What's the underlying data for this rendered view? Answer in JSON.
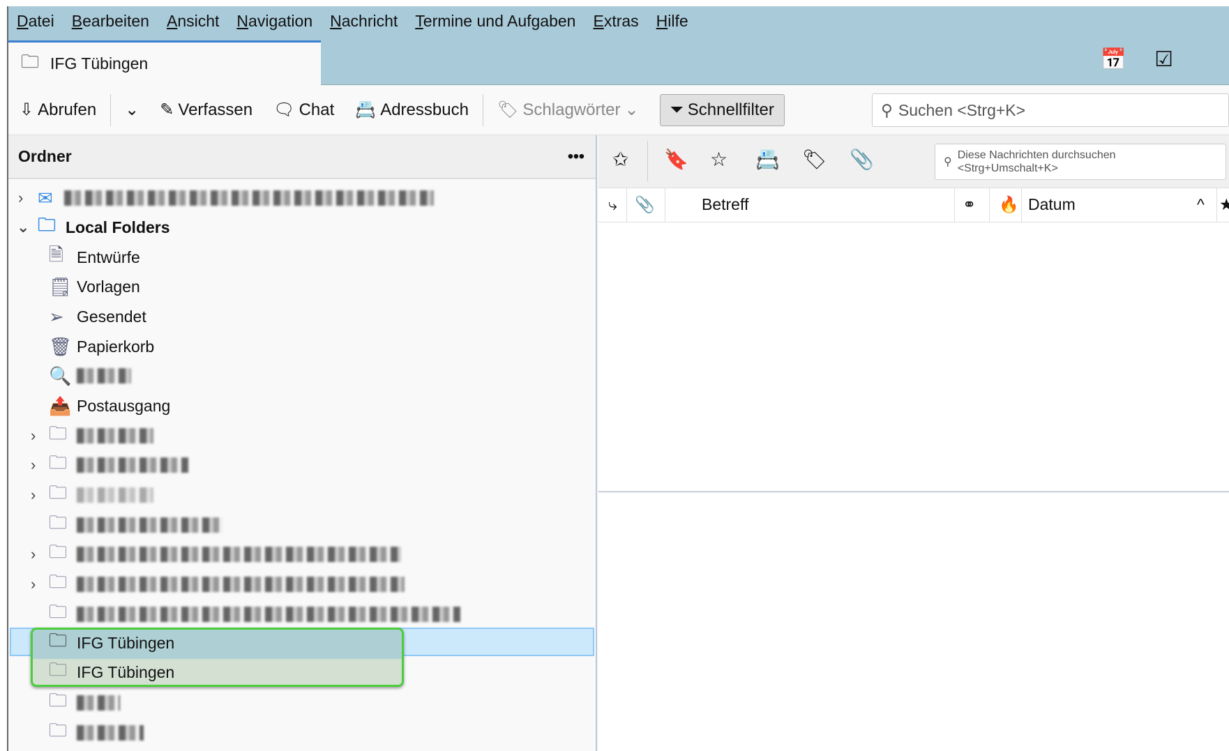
{
  "menu": [
    "Datei",
    "Bearbeiten",
    "Ansicht",
    "Navigation",
    "Nachricht",
    "Termine und Aufgaben",
    "Extras",
    "Hilfe"
  ],
  "tab": {
    "title": "IFG Tübingen"
  },
  "toolbar": {
    "get": "Abrufen",
    "write": "Verfassen",
    "chat": "Chat",
    "addressbook": "Adressbuch",
    "tags": "Schlagwörter",
    "quickfilter": "Schnellfilter",
    "search_placeholder": "Suchen <Strg+K>"
  },
  "folderpane": {
    "title": "Ordner",
    "more": "•••",
    "local": "Local Folders",
    "drafts": "Entwürfe",
    "templates": "Vorlagen",
    "sent": "Gesendet",
    "trash": "Papierkorb",
    "outbox": "Postausgang",
    "selected": "IFG Tübingen",
    "drag": "IFG Tübingen"
  },
  "quickfilter": {
    "search_placeholder": "Diese Nachrichten durchsuchen <Strg+Umschalt+K>"
  },
  "columns": {
    "subject": "Betreff",
    "date": "Datum"
  }
}
